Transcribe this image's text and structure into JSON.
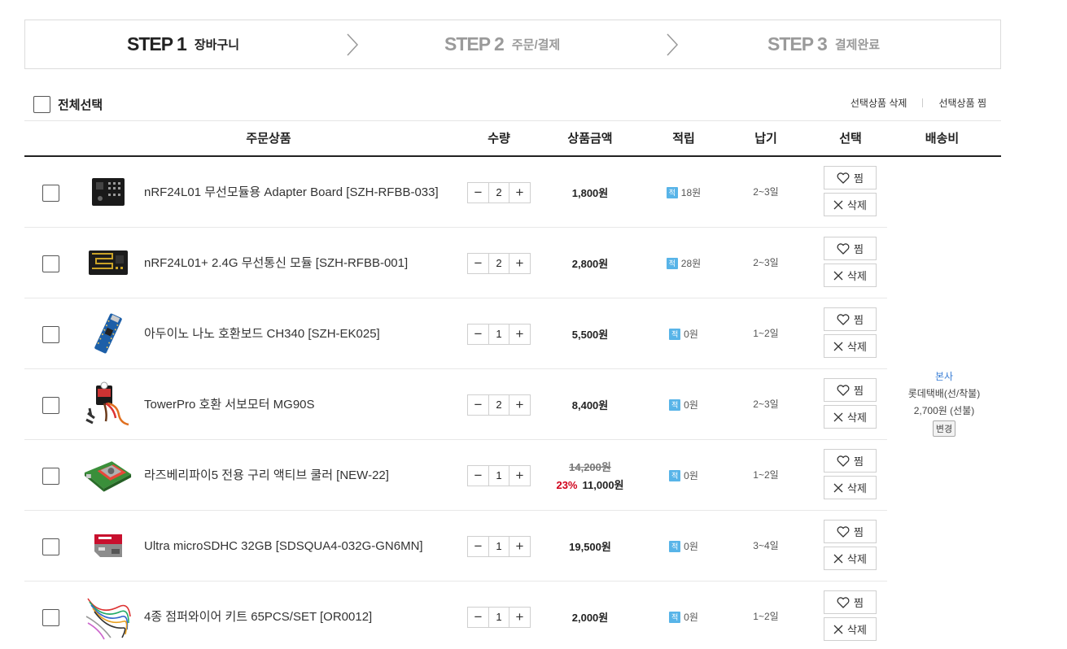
{
  "steps": [
    {
      "num": "STEP 1",
      "label": "장바구니"
    },
    {
      "num": "STEP 2",
      "label": "주문/결제"
    },
    {
      "num": "STEP 3",
      "label": "결제완료"
    }
  ],
  "toolbar": {
    "select_all": "전체선택",
    "delete_selected": "선택상품 삭제",
    "wish_selected": "선택상품 찜"
  },
  "columns": {
    "product": "주문상품",
    "qty": "수량",
    "amount": "상품금액",
    "points": "적립",
    "lead": "납기",
    "select": "선택",
    "shipping": "배송비"
  },
  "labels": {
    "wish": "찜",
    "delete": "삭제",
    "points_badge": "적"
  },
  "items": [
    {
      "name": "nRF24L01 무선모듈용 Adapter Board [SZH-RFBB-033]",
      "qty": "2",
      "price": "1,800원",
      "points": "18원",
      "lead": "2~3일"
    },
    {
      "name": "nRF24L01+ 2.4G 무선통신 모듈 [SZH-RFBB-001]",
      "qty": "2",
      "price": "2,800원",
      "points": "28원",
      "lead": "2~3일"
    },
    {
      "name": "아두이노 나노 호환보드 CH340 [SZH-EK025]",
      "qty": "1",
      "price": "5,500원",
      "points": "0원",
      "lead": "1~2일"
    },
    {
      "name": "TowerPro 호환 서보모터 MG90S",
      "qty": "2",
      "price": "8,400원",
      "points": "0원",
      "lead": "2~3일"
    },
    {
      "name": "라즈베리파이5 전용 구리 액티브 쿨러 [NEW-22]",
      "qty": "1",
      "orig_price": "14,200원",
      "discount": "23%",
      "price": "11,000원",
      "points": "0원",
      "lead": "1~2일"
    },
    {
      "name": "Ultra microSDHC 32GB [SDSQUA4-032G-GN6MN]",
      "qty": "1",
      "price": "19,500원",
      "points": "0원",
      "lead": "3~4일"
    },
    {
      "name": "4종 점퍼와이어 키트 65PCS/SET [OR0012]",
      "qty": "1",
      "price": "2,000원",
      "points": "0원",
      "lead": "1~2일"
    }
  ],
  "shipping": {
    "source": "본사",
    "carrier": "롯데택배(선/착불)",
    "fee": "2,700원 (선불)",
    "change": "변경"
  }
}
